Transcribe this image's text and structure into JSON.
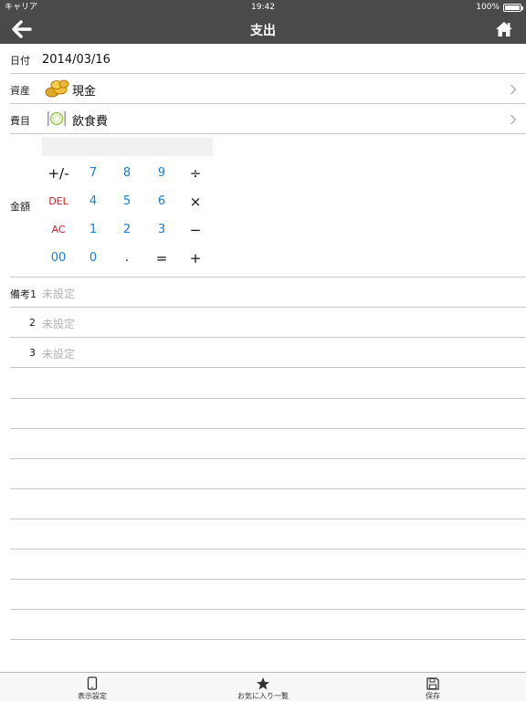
{
  "status_bar": {
    "carrier": "キャリア",
    "time": "19:42",
    "battery": "100%",
    "battery_level": 1.0
  },
  "nav": {
    "title": "支出",
    "back_icon": "arrow-left-icon",
    "home_icon": "home-icon"
  },
  "form": {
    "date": {
      "label": "日付",
      "value": "2014/03/16"
    },
    "asset": {
      "label": "資産",
      "value": "現金",
      "icon": "coins-icon"
    },
    "category": {
      "label": "費目",
      "value": "飲食費",
      "icon": "plate-icon"
    },
    "amount": {
      "label": "金額",
      "display_value": ""
    },
    "memos": [
      {
        "label": "備考1",
        "placeholder": "未設定"
      },
      {
        "label": "2",
        "placeholder": "未設定"
      },
      {
        "label": "3",
        "placeholder": "未設定"
      }
    ]
  },
  "keypad": {
    "rows": [
      [
        "+/-",
        "7",
        "8",
        "9",
        "÷"
      ],
      [
        "DEL",
        "4",
        "5",
        "6",
        "×"
      ],
      [
        "AC",
        "1",
        "2",
        "3",
        "−"
      ],
      [
        "00",
        "0",
        ".",
        "=",
        "+"
      ]
    ]
  },
  "tabbar": {
    "display_settings": {
      "label": "表示設定",
      "icon": "tablet-icon"
    },
    "favorites": {
      "label": "お気に入り一覧",
      "icon": "star-icon"
    },
    "save": {
      "label": "保存",
      "icon": "save-icon"
    }
  },
  "colors": {
    "bar": "#4a4a4a",
    "key_blue": "#1a7fd0",
    "key_red": "#d0202a",
    "separator": "#c8c8cc",
    "placeholder": "#b3b3b3"
  }
}
